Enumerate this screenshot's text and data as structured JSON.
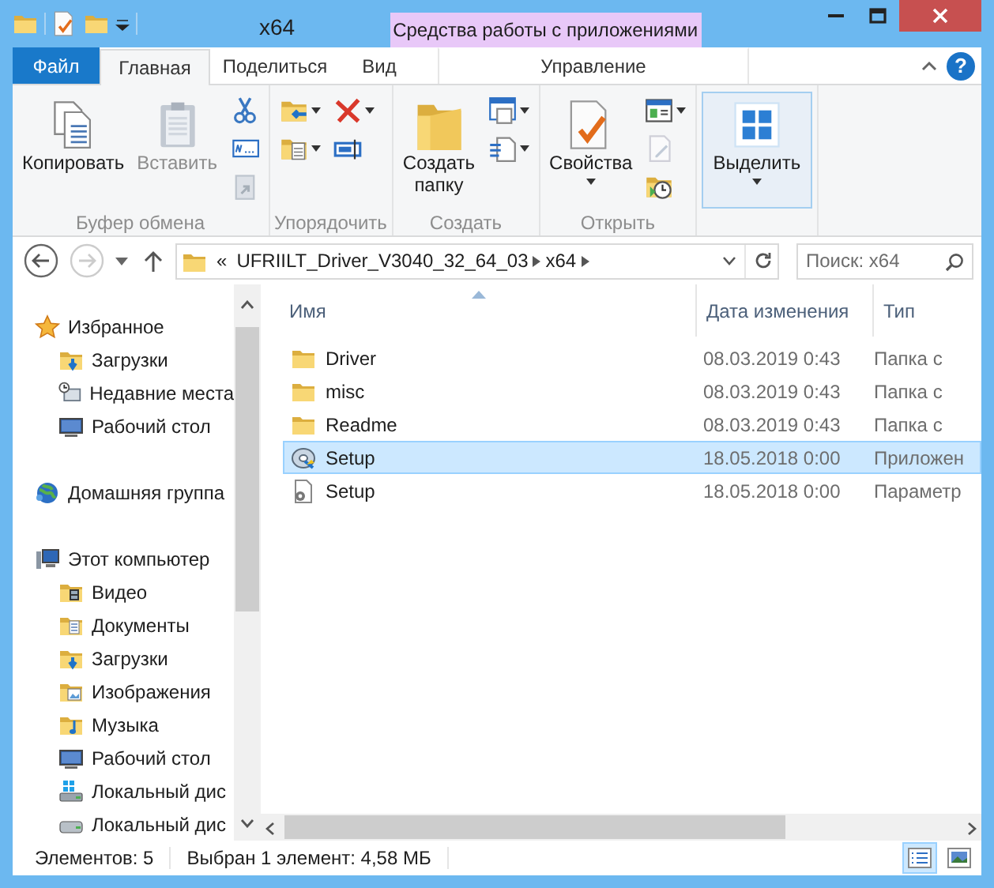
{
  "window": {
    "title": "x64",
    "context_header": "Средства работы с приложениями"
  },
  "tabs": [
    {
      "label": "Файл",
      "kind": "file",
      "selected": false
    },
    {
      "label": "Главная",
      "kind": "normal",
      "selected": true
    },
    {
      "label": "Поделиться",
      "kind": "normal",
      "selected": false
    },
    {
      "label": "Вид",
      "kind": "normal",
      "selected": false
    },
    {
      "label": "Управление",
      "kind": "contextual",
      "selected": false
    }
  ],
  "help_button": {
    "label": "?"
  },
  "ribbon": {
    "groups": [
      {
        "label": "Буфер обмена",
        "columns": [
          [
            {
              "kind": "copy",
              "label": [
                "Копировать"
              ],
              "caret": false,
              "disabled": false,
              "highlighted": false
            }
          ],
          [
            {
              "kind": "paste",
              "label": [
                "Вставить"
              ],
              "caret": false,
              "disabled": true,
              "highlighted": false
            }
          ],
          [
            {
              "kind": "cut",
              "caret": false,
              "disabled": false,
              "highlighted": false
            },
            {
              "kind": "copy-path",
              "caret": false,
              "disabled": false,
              "highlighted": false
            },
            {
              "kind": "paste-shortcut",
              "caret": false,
              "disabled": true,
              "highlighted": false
            }
          ]
        ]
      },
      {
        "label": "Упорядочить",
        "columns": [
          [
            {
              "kind": "move-to",
              "caret": true,
              "disabled": false,
              "highlighted": false
            },
            {
              "kind": "copy-to",
              "caret": true,
              "disabled": false,
              "highlighted": false
            }
          ],
          [
            {
              "kind": "delete",
              "caret": true,
              "disabled": false,
              "highlighted": false
            },
            {
              "kind": "rename",
              "caret": false,
              "disabled": false,
              "highlighted": false
            }
          ]
        ]
      },
      {
        "label": "Создать",
        "columns": [
          [
            {
              "kind": "new-folder",
              "label": [
                "Создать",
                "папку"
              ],
              "caret": false,
              "disabled": false,
              "highlighted": false
            }
          ],
          [
            {
              "kind": "new-item",
              "caret": true,
              "disabled": false,
              "highlighted": false
            },
            {
              "kind": "easy-access",
              "caret": true,
              "disabled": false,
              "highlighted": false
            }
          ]
        ]
      },
      {
        "label": "Открыть",
        "columns": [
          [
            {
              "kind": "properties",
              "label": [
                "Свойства"
              ],
              "caret": true,
              "disabled": false,
              "highlighted": false
            }
          ],
          [
            {
              "kind": "open",
              "caret": true,
              "disabled": false,
              "highlighted": false
            },
            {
              "kind": "edit",
              "caret": false,
              "disabled": true,
              "highlighted": false
            },
            {
              "kind": "history",
              "caret": false,
              "disabled": false,
              "highlighted": false
            }
          ]
        ]
      },
      {
        "columns": [
          [
            {
              "kind": "select",
              "label": [
                "Выделить"
              ],
              "caret": true,
              "disabled": false,
              "highlighted": true
            }
          ]
        ]
      }
    ]
  },
  "address": {
    "back_disabled": false,
    "forward_disabled": true,
    "overflow": "«",
    "crumbs": [
      "UFRIILT_Driver_V3040_32_64_03",
      "x64"
    ],
    "search": {
      "placeholder": "Поиск: x64"
    }
  },
  "nav": [
    {
      "label": "Избранное",
      "kind": "favorites",
      "children": [
        {
          "label": "Загрузки",
          "kind": "downloads"
        },
        {
          "label": "Недавние места",
          "kind": "recent"
        },
        {
          "label": "Рабочий стол",
          "kind": "desktop"
        }
      ]
    },
    {
      "label": "Домашняя группа",
      "kind": "homegroup"
    },
    {
      "label": "Этот компьютер",
      "kind": "computer",
      "children": [
        {
          "label": "Видео",
          "kind": "video"
        },
        {
          "label": "Документы",
          "kind": "documents"
        },
        {
          "label": "Загрузки",
          "kind": "downloads"
        },
        {
          "label": "Изображения",
          "kind": "pictures"
        },
        {
          "label": "Музыка",
          "kind": "music"
        },
        {
          "label": "Рабочий стол",
          "kind": "desktop"
        },
        {
          "label": "Локальный дис",
          "kind": "system-drive"
        },
        {
          "label": "Локальный дис",
          "kind": "drive"
        }
      ]
    }
  ],
  "table": {
    "columns": [
      {
        "label": "Имя",
        "sorted": true
      },
      {
        "label": "Дата изменения",
        "sorted": false
      },
      {
        "label": "Тип",
        "sorted": false
      }
    ],
    "rows": [
      {
        "name": "Driver",
        "kind": "folder",
        "date": "08.03.2019 0:43",
        "type": "Папка с",
        "selected": false
      },
      {
        "name": "misc",
        "kind": "folder",
        "date": "08.03.2019 0:43",
        "type": "Папка с",
        "selected": false
      },
      {
        "name": "Readme",
        "kind": "folder",
        "date": "08.03.2019 0:43",
        "type": "Папка с",
        "selected": false
      },
      {
        "name": "Setup",
        "kind": "app",
        "date": "18.05.2018 0:00",
        "type": "Приложен",
        "selected": true
      },
      {
        "name": "Setup",
        "kind": "config",
        "date": "18.05.2018 0:00",
        "type": "Параметр",
        "selected": false
      }
    ]
  },
  "status_bar": {
    "items_count": "Элементов: 5",
    "selection": "Выбран 1 элемент: 4,58 МБ",
    "views": [
      {
        "kind": "details",
        "selected": true
      },
      {
        "kind": "large-icons",
        "selected": false
      }
    ]
  }
}
